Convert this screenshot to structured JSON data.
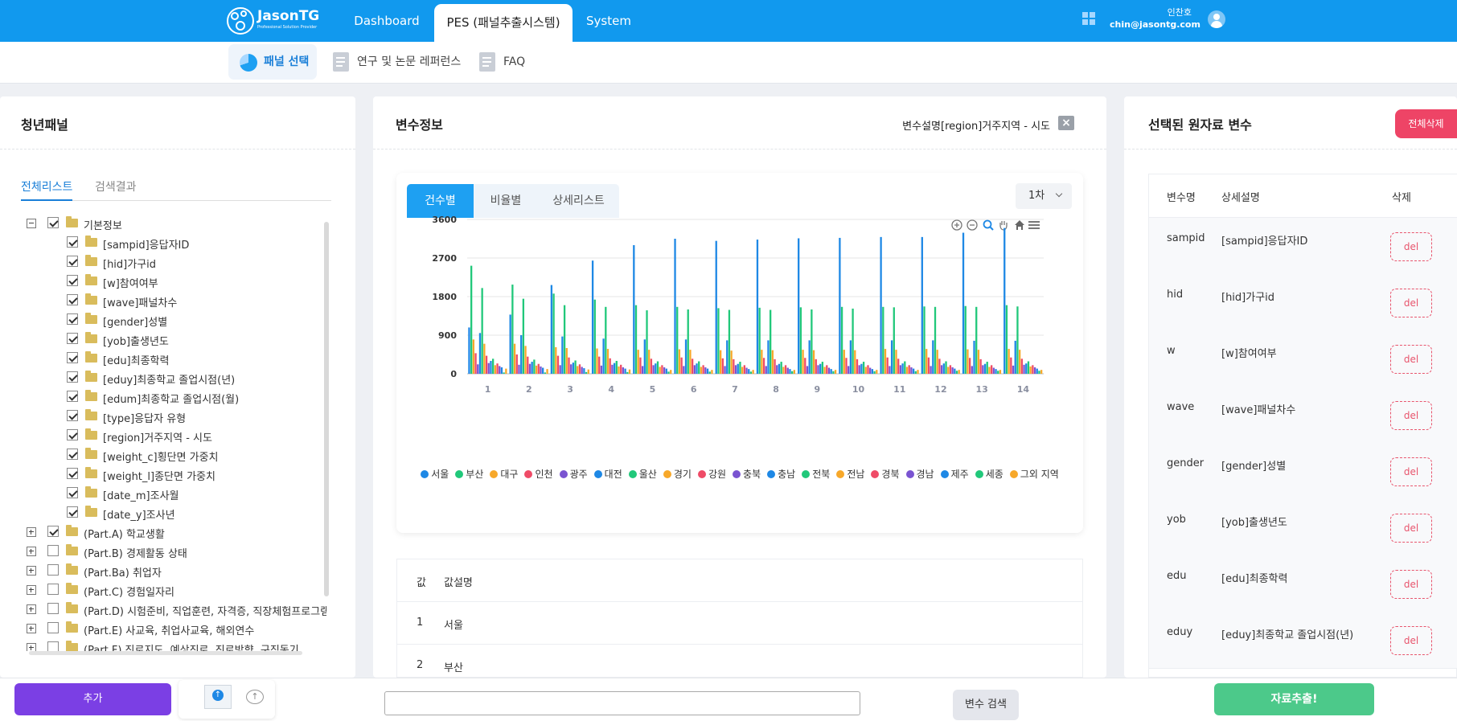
{
  "header": {
    "logo_title": "JasonTG",
    "logo_subtitle": "Professional Solution Provider",
    "nav": [
      "Dashboard",
      "PES (패널추출시스템)",
      "System"
    ],
    "user_name": "인찬호",
    "user_email": "chin@jasontg.com"
  },
  "subnav": {
    "items": [
      "패널 선택",
      "연구 및 논문 레퍼런스",
      "FAQ"
    ]
  },
  "left": {
    "title": "청년패널",
    "tabs": [
      "전체리스트",
      "검색결과"
    ],
    "add_button": "추가",
    "tree": [
      {
        "label": "기본정보",
        "level": 0,
        "toggle": "minus",
        "checked": true
      },
      {
        "label": "[sampid]응답자ID",
        "level": 1,
        "checked": true
      },
      {
        "label": "[hid]가구id",
        "level": 1,
        "checked": true
      },
      {
        "label": "[w]참여여부",
        "level": 1,
        "checked": true
      },
      {
        "label": "[wave]패널차수",
        "level": 1,
        "checked": true
      },
      {
        "label": "[gender]성별",
        "level": 1,
        "checked": true
      },
      {
        "label": "[yob]출생년도",
        "level": 1,
        "checked": true
      },
      {
        "label": "[edu]최종학력",
        "level": 1,
        "checked": true
      },
      {
        "label": "[eduy]최종학교 졸업시점(년)",
        "level": 1,
        "checked": true
      },
      {
        "label": "[edum]최종학교 졸업시점(월)",
        "level": 1,
        "checked": true
      },
      {
        "label": "[type]응답자 유형",
        "level": 1,
        "checked": true
      },
      {
        "label": "[region]거주지역 - 시도",
        "level": 1,
        "checked": true
      },
      {
        "label": "[weight_c]횡단면 가중치",
        "level": 1,
        "checked": true
      },
      {
        "label": "[weight_l]종단면 가중치",
        "level": 1,
        "checked": true
      },
      {
        "label": "[date_m]조사월",
        "level": 1,
        "checked": true
      },
      {
        "label": "[date_y]조사년",
        "level": 1,
        "checked": true
      },
      {
        "label": "(Part.A) 학교생활",
        "level": 0,
        "toggle": "plus",
        "checked": true
      },
      {
        "label": "(Part.B) 경제활동 상태",
        "level": 0,
        "toggle": "plus",
        "checked": false
      },
      {
        "label": "(Part.Ba) 취업자",
        "level": 0,
        "toggle": "plus",
        "checked": false
      },
      {
        "label": "(Part.C) 경험일자리",
        "level": 0,
        "toggle": "plus",
        "checked": false
      },
      {
        "label": "(Part.D) 시험준비, 직업훈련, 자격증, 직장체험프로그램",
        "level": 0,
        "toggle": "plus",
        "checked": false
      },
      {
        "label": "(Part.E) 사교육, 취업사교육, 해외연수",
        "level": 0,
        "toggle": "plus",
        "checked": false
      },
      {
        "label": "(Part.F) 진로지도, 예상진로, 진로방향, 구직동기",
        "level": 0,
        "toggle": "plus",
        "checked": false
      }
    ]
  },
  "middle": {
    "title": "변수정보",
    "var_desc": "변수설명[region]거주지역 - 시도",
    "chart_tabs": [
      "건수별",
      "비율별",
      "상세리스트"
    ],
    "wave_select": "1차",
    "value_header": [
      "값",
      "값설명"
    ],
    "values": [
      {
        "code": "1",
        "name": "서울"
      },
      {
        "code": "2",
        "name": "부산"
      }
    ],
    "search_button": "변수 검색",
    "search_value": ""
  },
  "right": {
    "title": "선택된 원자료 변수",
    "clear_button": "전체삭제",
    "headers": [
      "변수명",
      "상세설명",
      "삭제"
    ],
    "del_label": "del",
    "rows": [
      {
        "name": "sampid",
        "desc": "[sampid]응답자ID"
      },
      {
        "name": "hid",
        "desc": "[hid]가구id"
      },
      {
        "name": "w",
        "desc": "[w]참여여부"
      },
      {
        "name": "wave",
        "desc": "[wave]패널차수"
      },
      {
        "name": "gender",
        "desc": "[gender]성별"
      },
      {
        "name": "yob",
        "desc": "[yob]출생년도"
      },
      {
        "name": "edu",
        "desc": "[edu]최종학력"
      },
      {
        "name": "eduy",
        "desc": "[eduy]최종학교 졸업시점(년)"
      }
    ],
    "extract_button": "자료추출!"
  },
  "colors": {
    "primary": "#1199ee",
    "add_button": "#7b3fe4",
    "danger": "#ee4466",
    "extract": "#4cc98a"
  },
  "chart_data": {
    "type": "bar",
    "ylim": [
      0,
      3600
    ],
    "yticks": [
      0,
      900,
      1800,
      2700,
      3600
    ],
    "categories": [
      "1",
      "2",
      "3",
      "4",
      "5",
      "6",
      "7",
      "8",
      "9",
      "10",
      "11",
      "12",
      "13",
      "14"
    ],
    "series": [
      {
        "name": "서울",
        "color": "#1e88e5",
        "values": [
          1080,
          1380,
          2070,
          2640,
          3000,
          3150,
          3100,
          3130,
          3160,
          3170,
          3190,
          3190,
          3290,
          3400
        ]
      },
      {
        "name": "부산",
        "color": "#21c87a",
        "values": [
          2520,
          2080,
          1870,
          1730,
          1600,
          1560,
          1530,
          1540,
          1550,
          1560,
          1560,
          1570,
          1580,
          1600
        ]
      },
      {
        "name": "대구",
        "color": "#f7a82a",
        "values": [
          800,
          700,
          620,
          590,
          560,
          570,
          550,
          560,
          560,
          560,
          580,
          580,
          570,
          580
        ]
      },
      {
        "name": "인천",
        "color": "#ef4b67",
        "values": [
          480,
          450,
          420,
          400,
          380,
          380,
          360,
          370,
          370,
          370,
          380,
          380,
          370,
          380
        ]
      },
      {
        "name": "광주",
        "color": "#7a54d1",
        "values": [
          220,
          210,
          200,
          190,
          180,
          180,
          180,
          180,
          180,
          180,
          180,
          180,
          180,
          190
        ]
      },
      {
        "name": "대전",
        "color": "#1e88e5",
        "values": [
          950,
          900,
          870,
          820,
          800,
          800,
          780,
          780,
          780,
          780,
          780,
          780,
          770,
          770
        ]
      },
      {
        "name": "울산",
        "color": "#21c87a",
        "values": [
          2000,
          1750,
          1600,
          1560,
          1480,
          1500,
          1490,
          1490,
          1500,
          1520,
          1550,
          1560,
          1560,
          1570
        ]
      },
      {
        "name": "경기",
        "color": "#f7a82a",
        "values": [
          700,
          650,
          600,
          580,
          560,
          560,
          540,
          550,
          550,
          550,
          560,
          560,
          560,
          560
        ]
      },
      {
        "name": "강원",
        "color": "#ef4b67",
        "values": [
          420,
          400,
          380,
          360,
          350,
          350,
          340,
          340,
          340,
          340,
          350,
          350,
          340,
          350
        ]
      },
      {
        "name": "충북",
        "color": "#7a54d1",
        "values": [
          250,
          230,
          220,
          210,
          200,
          200,
          200,
          200,
          200,
          200,
          200,
          200,
          200,
          210
        ]
      },
      {
        "name": "충남",
        "color": "#1e88e5",
        "values": [
          300,
          280,
          260,
          250,
          240,
          240,
          230,
          230,
          230,
          230,
          240,
          240,
          230,
          240
        ]
      },
      {
        "name": "전북",
        "color": "#21c87a",
        "values": [
          350,
          330,
          310,
          300,
          290,
          290,
          280,
          280,
          280,
          280,
          290,
          290,
          280,
          290
        ]
      },
      {
        "name": "전남",
        "color": "#f7a82a",
        "values": [
          200,
          190,
          180,
          170,
          160,
          160,
          160,
          160,
          160,
          160,
          160,
          160,
          160,
          170
        ]
      },
      {
        "name": "경북",
        "color": "#ef4b67",
        "values": [
          240,
          230,
          220,
          210,
          200,
          200,
          200,
          200,
          200,
          200,
          200,
          200,
          200,
          200
        ]
      },
      {
        "name": "경남",
        "color": "#7a54d1",
        "values": [
          180,
          170,
          160,
          150,
          150,
          150,
          140,
          140,
          140,
          140,
          150,
          150,
          140,
          150
        ]
      },
      {
        "name": "제주",
        "color": "#1e88e5",
        "values": [
          150,
          140,
          130,
          120,
          120,
          120,
          110,
          110,
          110,
          110,
          120,
          120,
          110,
          120
        ]
      },
      {
        "name": "세종",
        "color": "#21c87a",
        "values": [
          30,
          30,
          40,
          40,
          50,
          50,
          50,
          60,
          60,
          60,
          60,
          70,
          70,
          70
        ]
      },
      {
        "name": "그외 지역",
        "color": "#f7a82a",
        "values": [
          120,
          110,
          100,
          100,
          90,
          90,
          90,
          90,
          90,
          90,
          90,
          90,
          90,
          90
        ]
      }
    ],
    "legend_position": "bottom"
  }
}
